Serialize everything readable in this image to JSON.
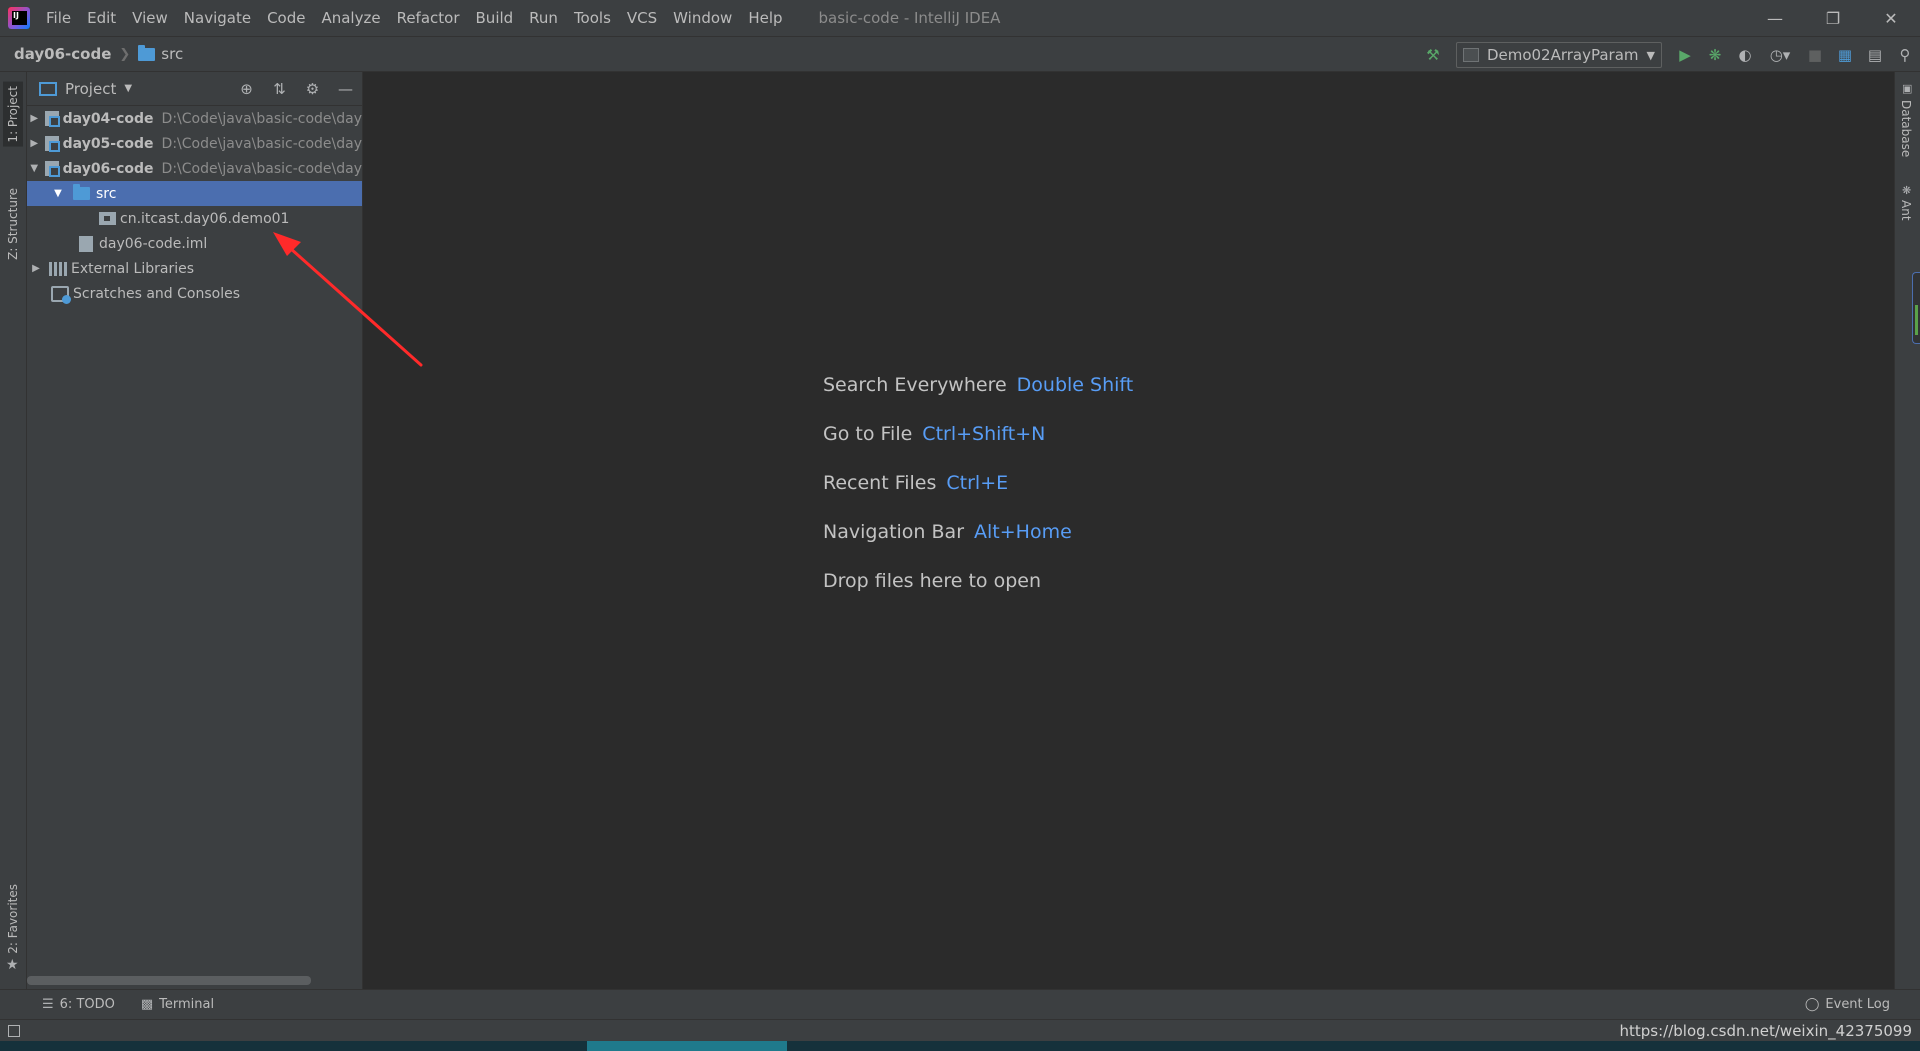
{
  "menu": [
    "File",
    "Edit",
    "View",
    "Navigate",
    "Code",
    "Analyze",
    "Refactor",
    "Build",
    "Run",
    "Tools",
    "VCS",
    "Window",
    "Help"
  ],
  "window_title": "basic-code - IntelliJ IDEA",
  "breadcrumb": {
    "project": "day06-code",
    "folder": "src"
  },
  "run_config": "Demo02ArrayParam",
  "left_tabs": {
    "project": "1: Project",
    "structure": "Z: Structure",
    "favorites": "2: Favorites"
  },
  "right_tabs": {
    "database": "Database",
    "ant": "Ant"
  },
  "project_panel": {
    "title": "Project"
  },
  "tree": [
    {
      "name": "day04-code",
      "path": "D:\\Code\\java\\basic-code\\day"
    },
    {
      "name": "day05-code",
      "path": "D:\\Code\\java\\basic-code\\day"
    },
    {
      "name": "day06-code",
      "path": "D:\\Code\\java\\basic-code\\day"
    },
    {
      "name": "src"
    },
    {
      "name": "cn.itcast.day06.demo01"
    },
    {
      "name": "day06-code.iml"
    },
    {
      "name": "External Libraries"
    },
    {
      "name": "Scratches and Consoles"
    }
  ],
  "hints": [
    {
      "label": "Search Everywhere",
      "key": "Double Shift"
    },
    {
      "label": "Go to File",
      "key": "Ctrl+Shift+N"
    },
    {
      "label": "Recent Files",
      "key": "Ctrl+E"
    },
    {
      "label": "Navigation Bar",
      "key": "Alt+Home"
    },
    {
      "label": "Drop files here to open"
    }
  ],
  "bottom_tabs": {
    "todo": "6: TODO",
    "terminal": "Terminal",
    "event_log": "Event Log"
  },
  "status_url": "https://blog.csdn.net/weixin_42375099",
  "colors": {
    "selection": "#4b6eaf",
    "shortcut": "#589df6",
    "annotation_arrow": "#ff2a2a",
    "folder": "#4e9ad6"
  },
  "icons": [
    "intellij-logo-icon",
    "build-hammer-icon",
    "run-icon",
    "debug-icon",
    "coverage-icon",
    "profile-icon",
    "stop-icon",
    "project-structure-icon",
    "search-icon",
    "locate-icon",
    "collapse-icon",
    "gear-icon",
    "minimize-icon"
  ]
}
